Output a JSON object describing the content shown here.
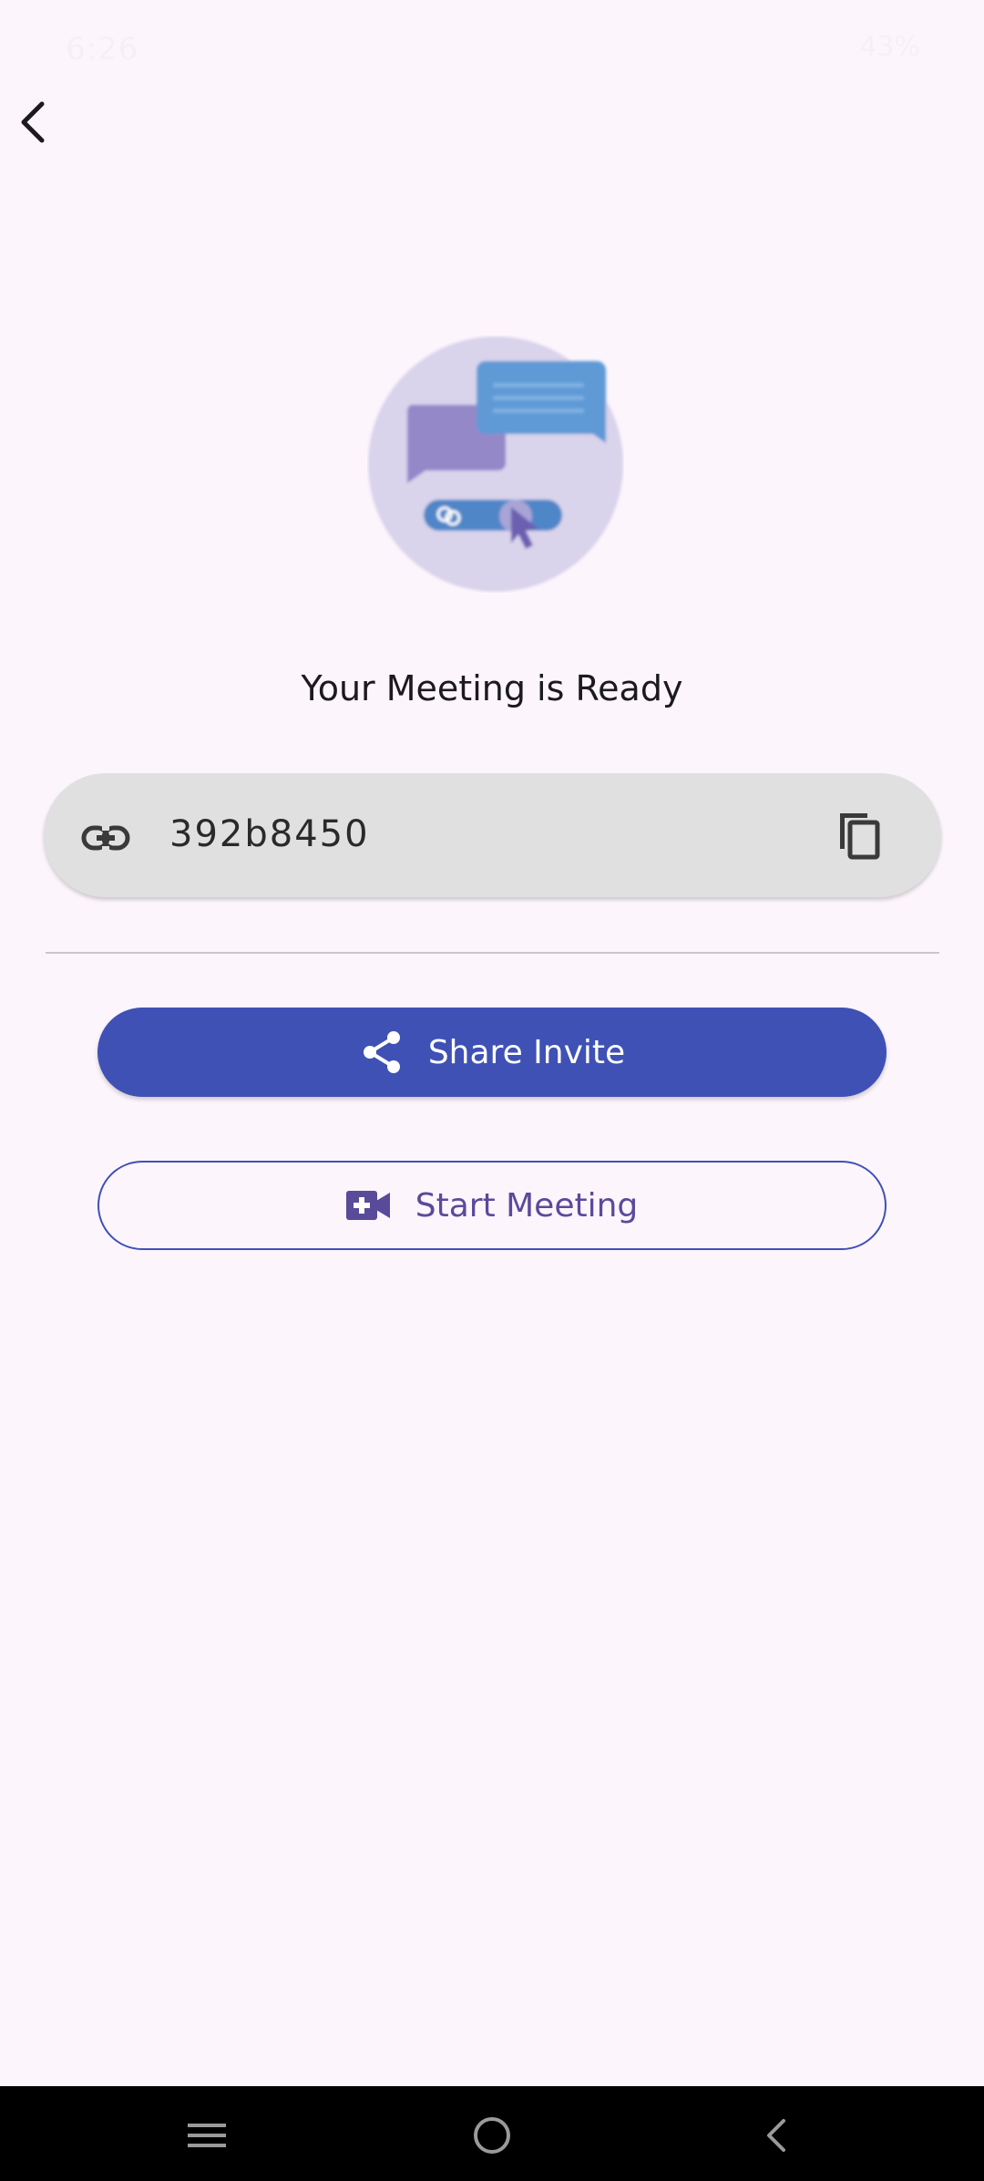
{
  "status_bar": {
    "time": "6:26",
    "battery": "43%"
  },
  "page": {
    "title": "Your Meeting is Ready",
    "meeting_code": "392b8450"
  },
  "actions": {
    "share_label": "Share Invite",
    "start_label": "Start Meeting"
  },
  "colors": {
    "background": "#fdf5fc",
    "primary": "#3f51b5",
    "outline_text": "#5a4a9a",
    "pill": "#e0e0e0"
  },
  "icons": {
    "back": "back-arrow-icon",
    "link": "link-icon",
    "copy": "copy-icon",
    "share": "share-icon",
    "video": "video-add-icon",
    "nav_recents": "recents-icon",
    "nav_home": "home-icon",
    "nav_back": "nav-back-icon"
  }
}
